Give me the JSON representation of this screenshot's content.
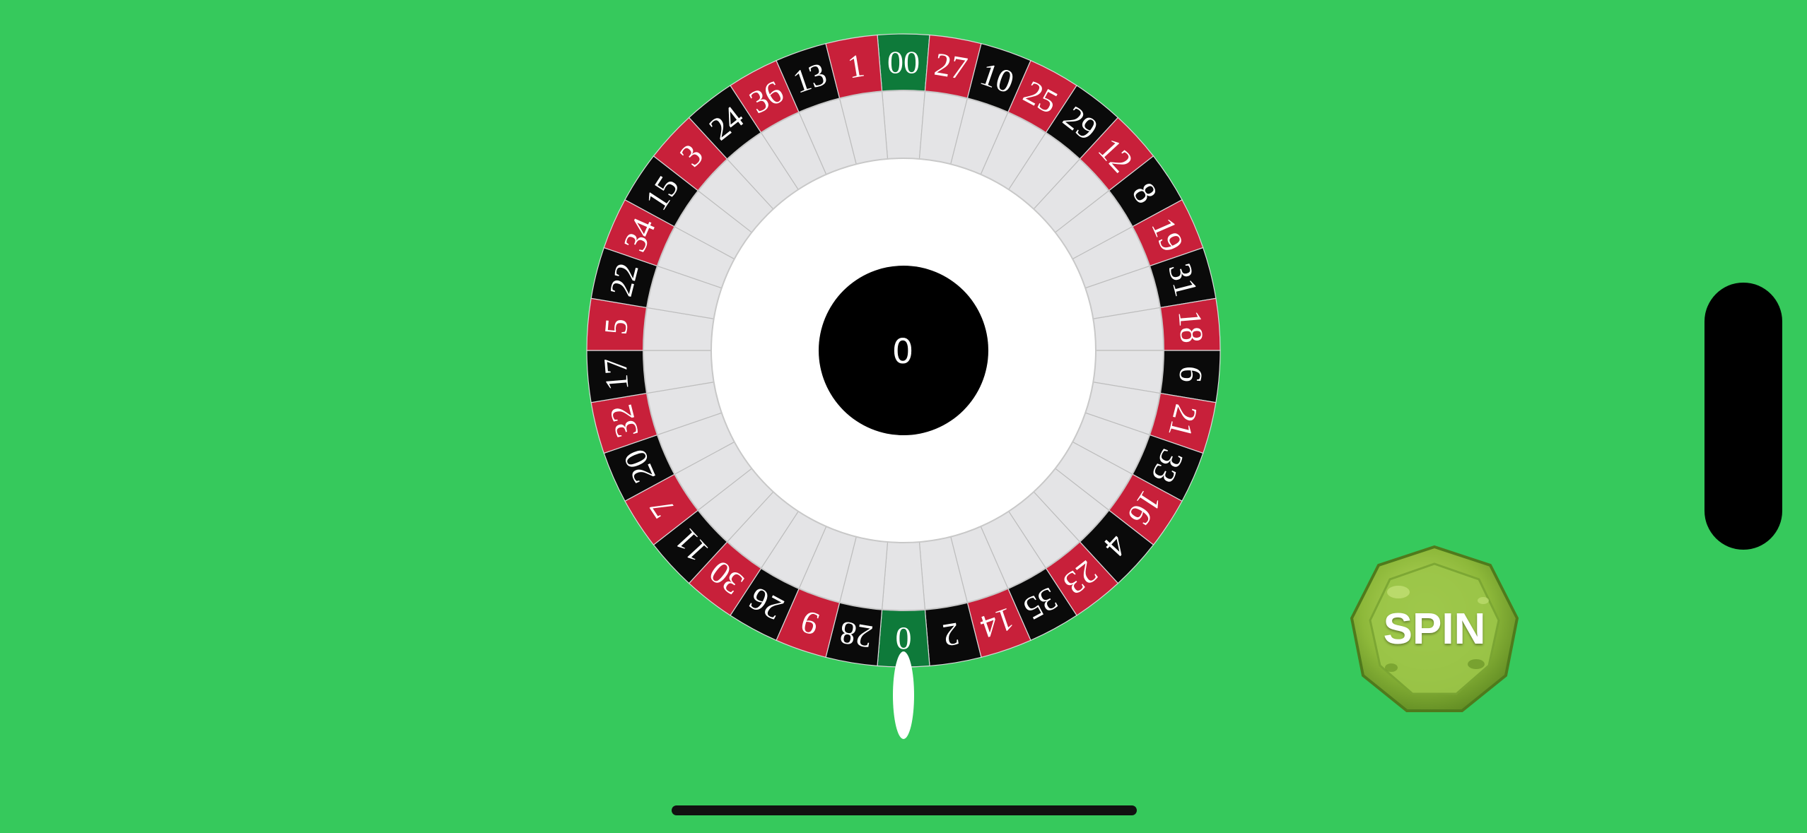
{
  "wheel": {
    "pockets": [
      {
        "number": "00",
        "color": "green"
      },
      {
        "number": "27",
        "color": "red"
      },
      {
        "number": "10",
        "color": "black"
      },
      {
        "number": "25",
        "color": "red"
      },
      {
        "number": "29",
        "color": "black"
      },
      {
        "number": "12",
        "color": "red"
      },
      {
        "number": "8",
        "color": "black"
      },
      {
        "number": "19",
        "color": "red"
      },
      {
        "number": "31",
        "color": "black"
      },
      {
        "number": "18",
        "color": "red"
      },
      {
        "number": "6",
        "color": "black"
      },
      {
        "number": "21",
        "color": "red"
      },
      {
        "number": "33",
        "color": "black"
      },
      {
        "number": "16",
        "color": "red"
      },
      {
        "number": "4",
        "color": "black"
      },
      {
        "number": "23",
        "color": "red"
      },
      {
        "number": "35",
        "color": "black"
      },
      {
        "number": "14",
        "color": "red"
      },
      {
        "number": "2",
        "color": "black"
      },
      {
        "number": "0",
        "color": "green"
      },
      {
        "number": "28",
        "color": "black"
      },
      {
        "number": "9",
        "color": "red"
      },
      {
        "number": "26",
        "color": "black"
      },
      {
        "number": "30",
        "color": "red"
      },
      {
        "number": "11",
        "color": "black"
      },
      {
        "number": "7",
        "color": "red"
      },
      {
        "number": "20",
        "color": "black"
      },
      {
        "number": "32",
        "color": "red"
      },
      {
        "number": "17",
        "color": "black"
      },
      {
        "number": "5",
        "color": "red"
      },
      {
        "number": "22",
        "color": "black"
      },
      {
        "number": "34",
        "color": "red"
      },
      {
        "number": "15",
        "color": "black"
      },
      {
        "number": "3",
        "color": "red"
      },
      {
        "number": "24",
        "color": "black"
      },
      {
        "number": "36",
        "color": "red"
      },
      {
        "number": "13",
        "color": "black"
      },
      {
        "number": "1",
        "color": "red"
      }
    ],
    "center_value": "0"
  },
  "spin_button": {
    "label": "SPIN"
  },
  "colors": {
    "background": "#36c95c",
    "red": "#c8203a",
    "black": "#0a0a0a",
    "green": "#0e7a3a",
    "inner_ring": "#e4e4e6",
    "hub": "#000000",
    "spin_fill": "#8db83a"
  }
}
